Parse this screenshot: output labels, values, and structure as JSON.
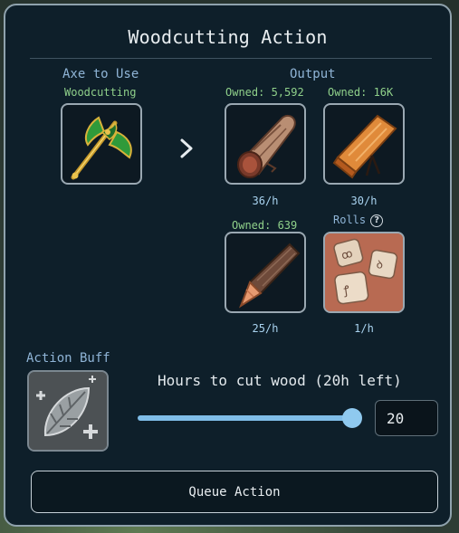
{
  "dialog": {
    "title": "Woodcutting Action",
    "axe_heading": "Axe to Use",
    "axe_skill_label": "Woodcutting",
    "output_heading": "Output",
    "next_icon": "chevron-right-icon",
    "outputs": [
      {
        "owned": "Owned: 5,592",
        "rate": "36/h",
        "icon": "log-icon"
      },
      {
        "owned": "Owned: 16K",
        "rate": "30/h",
        "icon": "plank-icon"
      },
      {
        "owned": "Owned: 639",
        "rate": "25/h",
        "icon": "stick-icon"
      },
      {
        "owned": "Rolls",
        "rate": "1/h",
        "icon": "dice-icon",
        "help_icon": "question-circle-icon"
      }
    ],
    "buff_heading": "Action Buff",
    "buff_icon": "leaf-buff-icon",
    "hours_label": "Hours to cut wood (20h left)",
    "hours_value": "20",
    "slider_fraction": 1.0,
    "queue_button": "Queue Action"
  },
  "colors": {
    "panel_bg": "#0e1f2a",
    "panel_border": "#8fa2ad",
    "heading_blue": "#8fb4d6",
    "owned_green": "#8fd08a",
    "rate_blue": "#a9d3f0",
    "slider_accent": "#7fbde8"
  }
}
